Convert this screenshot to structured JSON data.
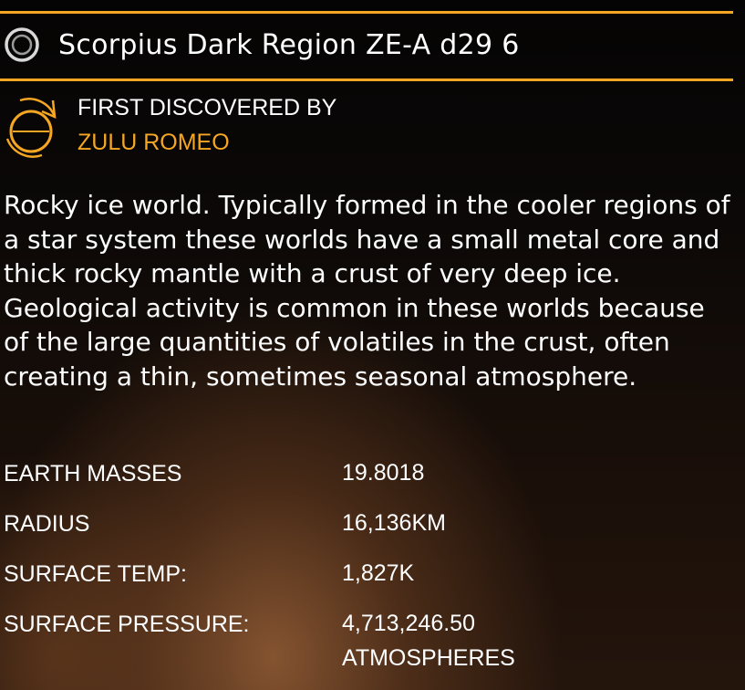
{
  "body": {
    "name": "Scorpius Dark Region ZE-A d29 6",
    "icon": "planet-orbit-icon"
  },
  "discovery": {
    "heading": "FIRST DISCOVERED BY",
    "commander": "ZULU ROMEO",
    "icon": "discovery-scan-icon"
  },
  "description": "Rocky ice world. Typically formed in the cooler regions of a star system these worlds have a small metal core and thick rocky mantle with a crust of very deep ice. Geological activity is common in these worlds because of the large quantities of volatiles in the crust, often creating a thin, sometimes seasonal atmosphere.",
  "stats": [
    {
      "label": "EARTH MASSES",
      "value": "19.8018"
    },
    {
      "label": "RADIUS",
      "value": "16,136KM"
    },
    {
      "label": "SURFACE TEMP:",
      "value": "1,827K"
    },
    {
      "label": "SURFACE PRESSURE:",
      "value": "4,713,246.50 ATMOSPHERES"
    }
  ],
  "colors": {
    "accent": "#f5a623",
    "text": "#ffffff",
    "background": "#0b0807"
  }
}
